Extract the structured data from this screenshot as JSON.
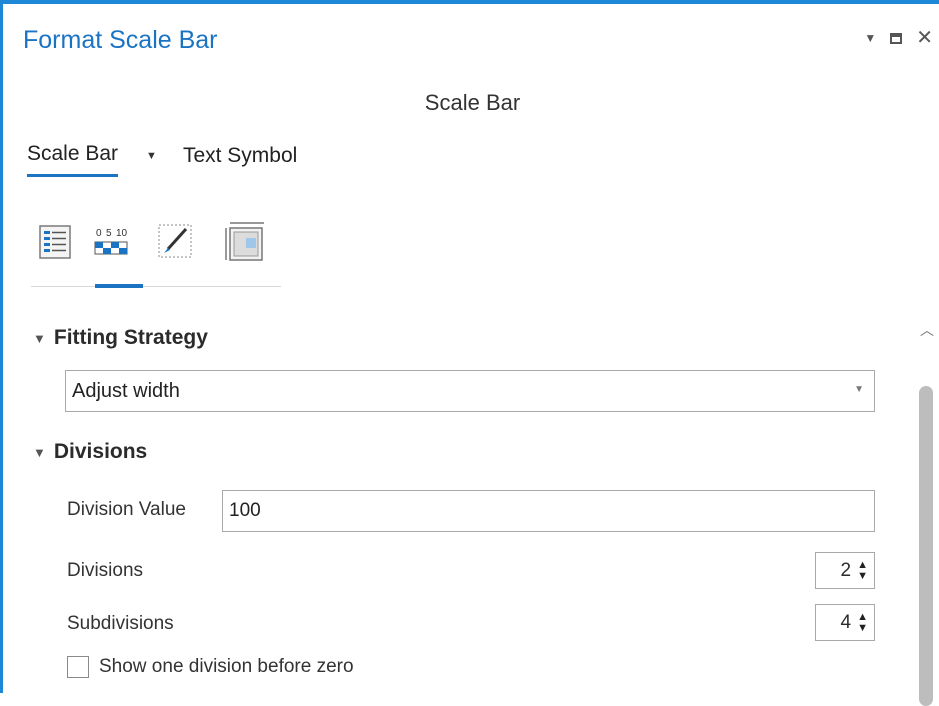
{
  "pane": {
    "title": "Format Scale Bar",
    "element_name": "Scale Bar"
  },
  "window_controls": {
    "dropdown_icon": "chevron-down-icon",
    "maximize_icon": "maximize-icon",
    "close_icon": "close-icon"
  },
  "sub_tabs": {
    "primary": "Scale Bar",
    "secondary": "Text Symbol"
  },
  "icon_tabs": [
    {
      "icon": "properties-icon",
      "active": false
    },
    {
      "icon": "scale-bar-divisions-icon",
      "active": true
    },
    {
      "icon": "brush-icon",
      "active": false
    },
    {
      "icon": "display-frame-icon",
      "active": false
    }
  ],
  "scale_bar_icon_labels": [
    "0",
    "5",
    "10"
  ],
  "fitting_strategy": {
    "header": "Fitting Strategy",
    "value": "Adjust width"
  },
  "divisions": {
    "header": "Divisions",
    "division_value_label": "Division Value",
    "division_value": "100",
    "divisions_label": "Divisions",
    "divisions_value": "2",
    "subdivisions_label": "Subdivisions",
    "subdivisions_value": "4",
    "checkbox_label": "Show one division before zero",
    "checkbox_checked": false
  },
  "colors": {
    "accent": "#1b73c4",
    "border_accent": "#1e88d6"
  }
}
